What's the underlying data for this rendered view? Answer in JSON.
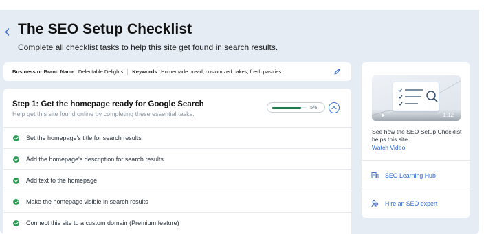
{
  "header": {
    "title": "The SEO Setup Checklist",
    "subtitle": "Complete all checklist tasks to help this site get found in search results."
  },
  "business_info": {
    "brand_label": "Business or Brand Name:",
    "brand_value": "Delectable Delights",
    "keywords_label": "Keywords:",
    "keywords_value": "Homemade bread, customized cakes, fresh pastries"
  },
  "step": {
    "title": "Step 1: Get the homepage ready for Google Search",
    "subtitle": "Help get this site found online by completing these essential tasks.",
    "progress_text": "5/6",
    "progress_fraction": 0.833,
    "tasks": [
      {
        "label": "Set the homepage's title for search results",
        "done": true
      },
      {
        "label": "Add the homepage's description for search results",
        "done": true
      },
      {
        "label": "Add text to the homepage",
        "done": true
      },
      {
        "label": "Make the homepage visible in search results",
        "done": true
      },
      {
        "label": "Connect this site to a custom domain (Premium feature)",
        "done": true
      }
    ]
  },
  "side_panel": {
    "video_duration": "1:12",
    "description": "See how the SEO Setup Checklist helps this site.",
    "watch_link": "Watch Video",
    "links": [
      {
        "label": "SEO Learning Hub",
        "icon": "learning-hub-icon"
      },
      {
        "label": "Hire an SEO expert",
        "icon": "expert-icon"
      }
    ]
  },
  "colors": {
    "accent": "#2f6bd6",
    "success": "#2b9b54",
    "progress": "#1e7a4a",
    "background": "#e6ecf4"
  }
}
